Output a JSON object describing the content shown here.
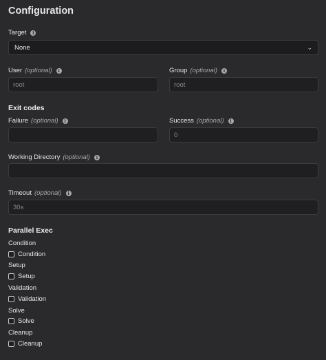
{
  "title": "Configuration",
  "target": {
    "label": "Target",
    "value": "None"
  },
  "user": {
    "label": "User",
    "optional": "(optional)",
    "placeholder": "root"
  },
  "group": {
    "label": "Group",
    "optional": "(optional)",
    "placeholder": "root"
  },
  "exit_codes": {
    "heading": "Exit codes",
    "failure": {
      "label": "Failure",
      "optional": "(optional)",
      "value": ""
    },
    "success": {
      "label": "Success",
      "optional": "(optional)",
      "placeholder": "0"
    }
  },
  "working_directory": {
    "label": "Working Directory",
    "optional": "(optional)",
    "value": ""
  },
  "timeout": {
    "label": "Timeout",
    "optional": "(optional)",
    "placeholder": "30s"
  },
  "parallel_exec": {
    "heading": "Parallel Exec",
    "items": [
      {
        "group_label": "Condition",
        "checkbox_label": "Condition"
      },
      {
        "group_label": "Setup",
        "checkbox_label": "Setup"
      },
      {
        "group_label": "Validation",
        "checkbox_label": "Validation"
      },
      {
        "group_label": "Solve",
        "checkbox_label": "Solve"
      },
      {
        "group_label": "Cleanup",
        "checkbox_label": "Cleanup"
      }
    ]
  }
}
